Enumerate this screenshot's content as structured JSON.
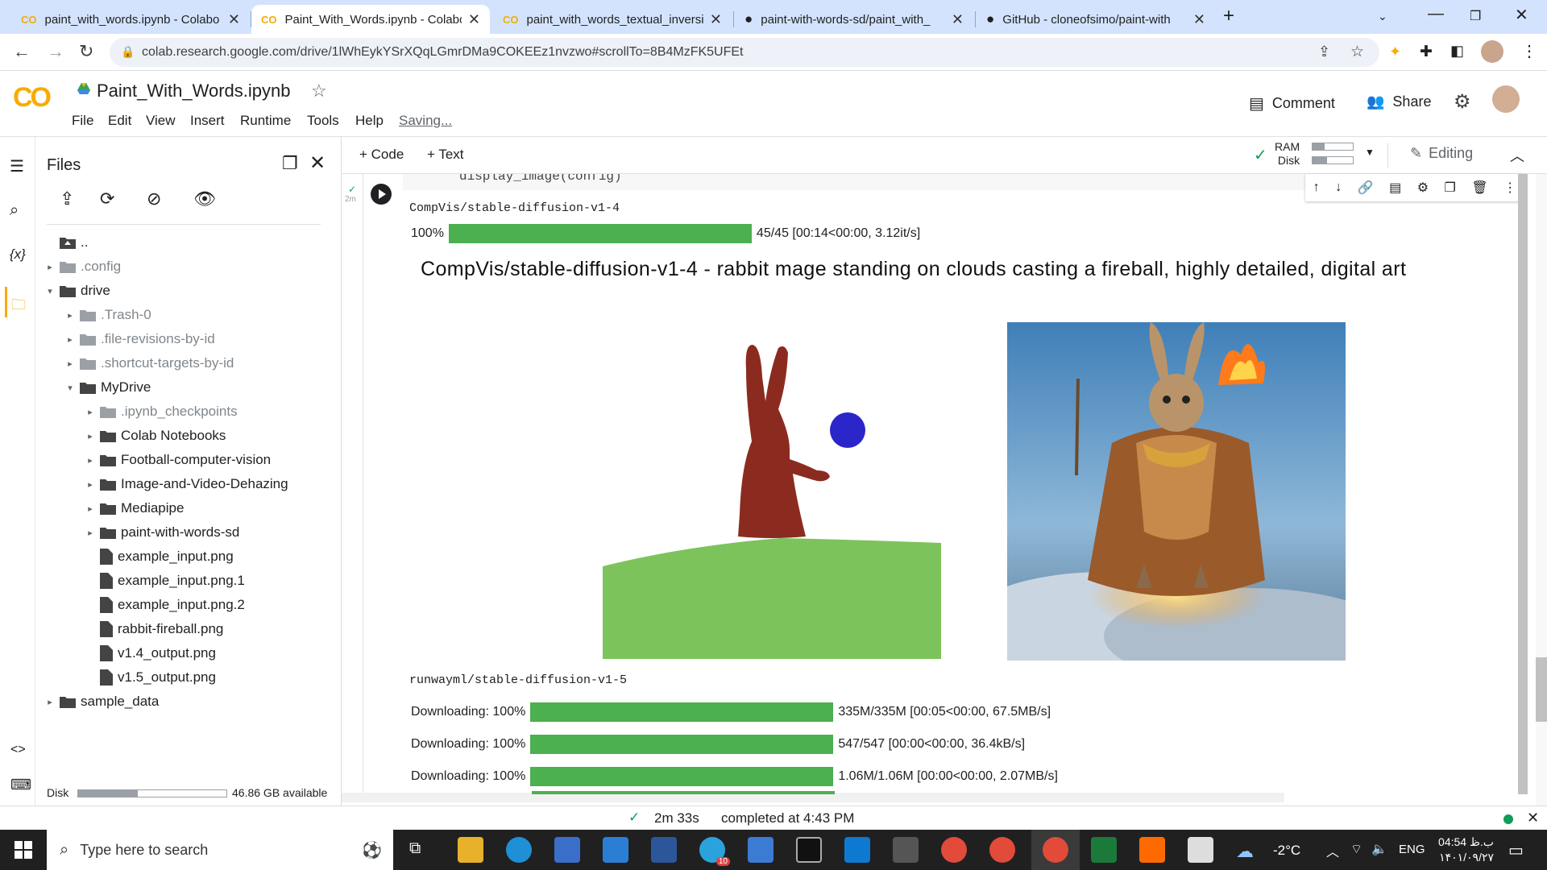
{
  "browser": {
    "tabs": [
      {
        "title": "paint_with_words.ipynb - Colabo",
        "icon": "colab-icon",
        "active": false
      },
      {
        "title": "Paint_With_Words.ipynb - Colabo",
        "icon": "colab-icon",
        "active": true
      },
      {
        "title": "paint_with_words_textual_inversio",
        "icon": "colab-icon",
        "active": false
      },
      {
        "title": "paint-with-words-sd/paint_with_",
        "icon": "github-icon",
        "active": false
      },
      {
        "title": "GitHub - cloneofsimo/paint-with",
        "icon": "github-icon",
        "active": false
      }
    ],
    "url": "colab.research.google.com/drive/1lWhEykYSrXQqLGmrDMa9COKEEz1nvzwo#scrollTo=8B4MzFK5UFEt"
  },
  "colab": {
    "logo": "CO",
    "notebook_title": "Paint_With_Words.ipynb",
    "menu": [
      "File",
      "Edit",
      "View",
      "Insert",
      "Runtime",
      "Tools",
      "Help"
    ],
    "saving": "Saving...",
    "comment_label": "Comment",
    "share_label": "Share"
  },
  "sidebar": {
    "title": "Files",
    "disk_label": "Disk",
    "disk_available": "46.86 GB available",
    "disk_used_fraction": 0.4,
    "tree": [
      {
        "name": "..",
        "depth": 0,
        "type": "up",
        "caret": ""
      },
      {
        "name": ".config",
        "depth": 0,
        "type": "folder",
        "caret": "▸",
        "grey": true
      },
      {
        "name": "drive",
        "depth": 0,
        "type": "folder",
        "caret": "▾"
      },
      {
        "name": ".Trash-0",
        "depth": 1,
        "type": "folder",
        "caret": "▸",
        "grey": true
      },
      {
        "name": ".file-revisions-by-id",
        "depth": 1,
        "type": "folder",
        "caret": "▸",
        "grey": true
      },
      {
        "name": ".shortcut-targets-by-id",
        "depth": 1,
        "type": "folder",
        "caret": "▸",
        "grey": true
      },
      {
        "name": "MyDrive",
        "depth": 1,
        "type": "folder",
        "caret": "▾"
      },
      {
        "name": ".ipynb_checkpoints",
        "depth": 2,
        "type": "folder",
        "caret": "▸",
        "grey": true
      },
      {
        "name": "Colab Notebooks",
        "depth": 2,
        "type": "folder",
        "caret": "▸"
      },
      {
        "name": "Football-computer-vision",
        "depth": 2,
        "type": "folder",
        "caret": "▸"
      },
      {
        "name": "Image-and-Video-Dehazing",
        "depth": 2,
        "type": "folder",
        "caret": "▸"
      },
      {
        "name": "Mediapipe",
        "depth": 2,
        "type": "folder",
        "caret": "▸"
      },
      {
        "name": "paint-with-words-sd",
        "depth": 2,
        "type": "folder",
        "caret": "▸"
      },
      {
        "name": "example_input.png",
        "depth": 2,
        "type": "file",
        "caret": ""
      },
      {
        "name": "example_input.png.1",
        "depth": 2,
        "type": "file",
        "caret": ""
      },
      {
        "name": "example_input.png.2",
        "depth": 2,
        "type": "file",
        "caret": ""
      },
      {
        "name": "rabbit-fireball.png",
        "depth": 2,
        "type": "file",
        "caret": ""
      },
      {
        "name": "v1.4_output.png",
        "depth": 2,
        "type": "file",
        "caret": ""
      },
      {
        "name": "v1.5_output.png",
        "depth": 2,
        "type": "file",
        "caret": ""
      },
      {
        "name": "sample_data",
        "depth": 0,
        "type": "folder",
        "caret": "▸"
      }
    ]
  },
  "toolbar": {
    "code_label": "+ Code",
    "text_label": "+ Text",
    "ram_label": "RAM",
    "disk_label": "Disk",
    "editing_label": "Editing",
    "ram_used_fraction": 0.3,
    "disk_used_fraction": 0.35
  },
  "cell": {
    "code_line": "display_image(config)",
    "exec_time": "2m",
    "model1": "CompVis/stable-diffusion-v1-4",
    "progress1": {
      "prefix": "100%",
      "fraction": 1.0,
      "stats": "45/45 [00:14<00:00, 3.12it/s]"
    },
    "figure_title": "CompVis/stable-diffusion-v1-4 - rabbit mage standing on clouds casting a fireball, highly detailed, digital art",
    "model2": "runwayml/stable-diffusion-v1-5",
    "downloads": [
      {
        "prefix": "Downloading: 100%",
        "fraction": 1.0,
        "stats": "335M/335M [00:05<00:00, 67.5MB/s]"
      },
      {
        "prefix": "Downloading: 100%",
        "fraction": 1.0,
        "stats": "547/547 [00:00<00:00, 36.4kB/s]"
      },
      {
        "prefix": "Downloading: 100%",
        "fraction": 1.0,
        "stats": "1.06M/1.06M [00:00<00:00, 2.07MB/s]"
      }
    ]
  },
  "status": {
    "duration": "2m 33s",
    "completed": "completed at 4:43 PM"
  },
  "taskbar": {
    "search_placeholder": "Type here to search",
    "temperature": "-2°C",
    "lang": "ENG",
    "time": "04:54 ب.ظ",
    "date": "۱۴۰۱/۰۹/۲۷",
    "telegram_badge": "10"
  },
  "colors": {
    "accent": "#f9ab00",
    "progress": "#4caf50",
    "rabbit": "#8b2b1f",
    "ball": "#2a26c9",
    "grass": "#7cc35b"
  }
}
